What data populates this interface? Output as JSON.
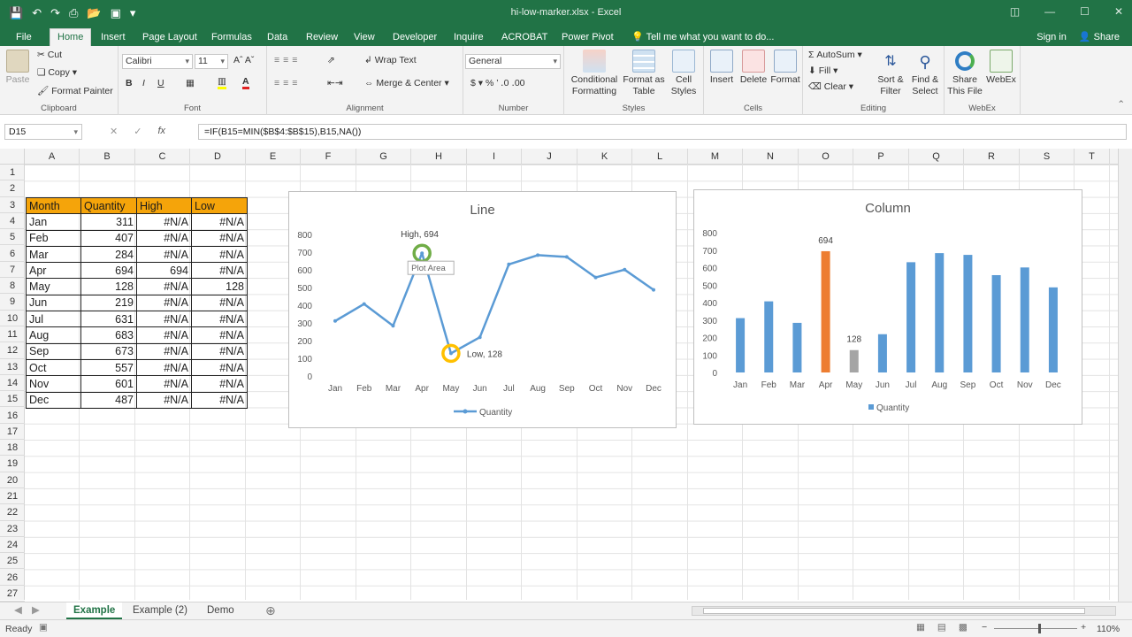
{
  "window": {
    "title": "hi-low-marker.xlsx - Excel",
    "accent": "#217346"
  },
  "tabs": [
    "File",
    "Home",
    "Insert",
    "Page Layout",
    "Formulas",
    "Data",
    "Review",
    "View",
    "Developer",
    "Inquire",
    "ACROBAT",
    "Power Pivot"
  ],
  "active_tab": "Home",
  "tell_me": "Tell me what you want to do...",
  "sign_in": "Sign in",
  "share": "Share",
  "ribbon": {
    "clipboard": {
      "paste": "Paste",
      "cut": "Cut",
      "copy": "Copy",
      "format_painter": "Format Painter",
      "name": "Clipboard"
    },
    "font": {
      "family": "Calibri",
      "size": "11",
      "name": "Font"
    },
    "alignment": {
      "wrap": "Wrap Text",
      "merge": "Merge & Center",
      "name": "Alignment"
    },
    "number": {
      "format": "General",
      "name": "Number"
    },
    "styles": {
      "conditional": "Conditional",
      "conditional2": "Formatting",
      "format_as": "Format as",
      "format_as2": "Table",
      "cell_styles": "Cell",
      "cell_styles2": "Styles",
      "name": "Styles"
    },
    "cells": {
      "insert": "Insert",
      "delete": "Delete",
      "format": "Format",
      "name": "Cells"
    },
    "editing": {
      "autosum": "AutoSum",
      "fill": "Fill",
      "clear": "Clear",
      "sort": "Sort &",
      "sort2": "Filter",
      "find": "Find &",
      "find2": "Select",
      "name": "Editing"
    },
    "share_file": {
      "label1": "Share",
      "label2": "This File"
    },
    "webex": {
      "label": "WebEx",
      "name": "WebEx"
    }
  },
  "formula_bar": {
    "name_box": "D15",
    "formula": "=IF(B15=MIN($B$4:$B$15),B15,NA())"
  },
  "columns": [
    "A",
    "B",
    "C",
    "D",
    "E",
    "F",
    "G",
    "H",
    "I",
    "J",
    "K",
    "L",
    "M",
    "N",
    "O",
    "P",
    "Q",
    "R",
    "S",
    "T"
  ],
  "rows": [
    "1",
    "2",
    "3",
    "4",
    "5",
    "6",
    "7",
    "8",
    "9",
    "10",
    "11",
    "12",
    "13",
    "14",
    "15",
    "16",
    "17",
    "18",
    "19",
    "20",
    "21",
    "22",
    "23",
    "24",
    "25",
    "26",
    "27"
  ],
  "table": {
    "headers": [
      "Month",
      "Quantity",
      "High",
      "Low"
    ],
    "header_color": "#f5a40a",
    "rows": [
      [
        "Jan",
        "311",
        "#N/A",
        "#N/A"
      ],
      [
        "Feb",
        "407",
        "#N/A",
        "#N/A"
      ],
      [
        "Mar",
        "284",
        "#N/A",
        "#N/A"
      ],
      [
        "Apr",
        "694",
        "694",
        "#N/A"
      ],
      [
        "May",
        "128",
        "#N/A",
        "128"
      ],
      [
        "Jun",
        "219",
        "#N/A",
        "#N/A"
      ],
      [
        "Jul",
        "631",
        "#N/A",
        "#N/A"
      ],
      [
        "Aug",
        "683",
        "#N/A",
        "#N/A"
      ],
      [
        "Sep",
        "673",
        "#N/A",
        "#N/A"
      ],
      [
        "Oct",
        "557",
        "#N/A",
        "#N/A"
      ],
      [
        "Nov",
        "601",
        "#N/A",
        "#N/A"
      ],
      [
        "Dec",
        "487",
        "#N/A",
        "#N/A"
      ]
    ]
  },
  "chart_data": [
    {
      "type": "line",
      "title": "Line",
      "categories": [
        "Jan",
        "Feb",
        "Mar",
        "Apr",
        "May",
        "Jun",
        "Jul",
        "Aug",
        "Sep",
        "Oct",
        "Nov",
        "Dec"
      ],
      "series": [
        {
          "name": "Quantity",
          "values": [
            311,
            407,
            284,
            694,
            128,
            219,
            631,
            683,
            673,
            557,
            601,
            487
          ],
          "color": "#5b9bd5"
        }
      ],
      "yticks": [
        "0",
        "100",
        "200",
        "300",
        "400",
        "500",
        "600",
        "700",
        "800"
      ],
      "ylim": [
        0,
        800
      ],
      "annotations": {
        "high": "High, 694",
        "low": "Low, 128",
        "tooltip": "Plot Area"
      },
      "marker_colors": {
        "high": "#70ad47",
        "low": "#ffc000"
      },
      "legend": "bottom"
    },
    {
      "type": "bar",
      "title": "Column",
      "categories": [
        "Jan",
        "Feb",
        "Mar",
        "Apr",
        "May",
        "Jun",
        "Jul",
        "Aug",
        "Sep",
        "Oct",
        "Nov",
        "Dec"
      ],
      "series": [
        {
          "name": "Quantity",
          "values": [
            311,
            407,
            284,
            694,
            128,
            219,
            631,
            683,
            673,
            557,
            601,
            487
          ],
          "color": "#5b9bd5"
        }
      ],
      "highlight": {
        "high_color": "#ed7d31",
        "low_color": "#a5a5a5",
        "high_label": "694",
        "low_label": "128"
      },
      "yticks": [
        "0",
        "100",
        "200",
        "300",
        "400",
        "500",
        "600",
        "700",
        "800"
      ],
      "ylim": [
        0,
        800
      ],
      "legend": "bottom"
    }
  ],
  "sheet_tabs": [
    "Example",
    "Example (2)",
    "Demo"
  ],
  "active_sheet": "Example",
  "status": {
    "ready": "Ready",
    "zoom": "110%"
  }
}
